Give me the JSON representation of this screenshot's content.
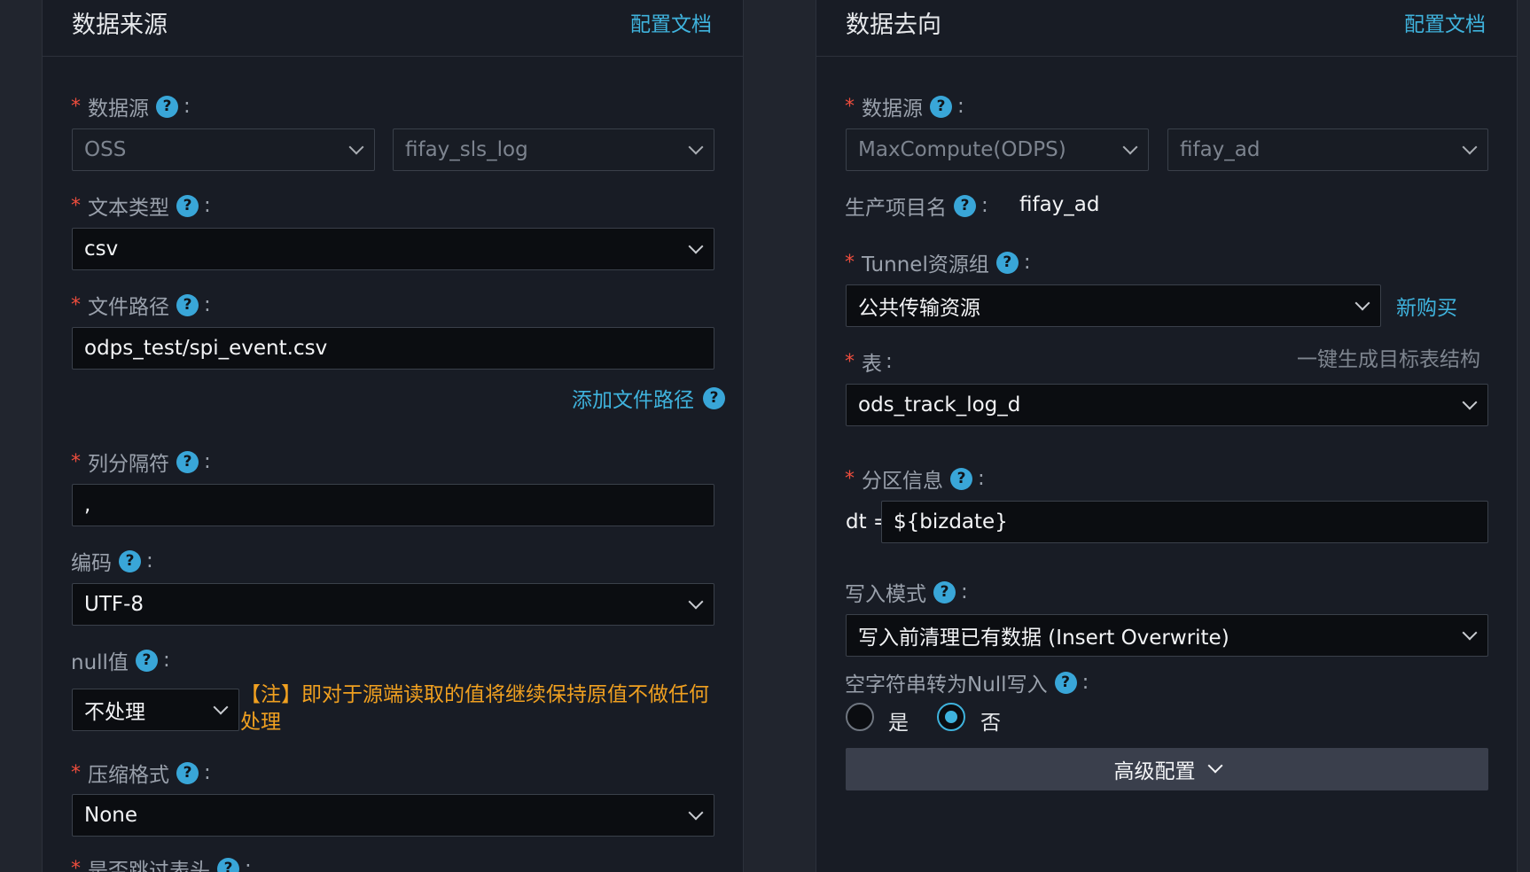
{
  "source": {
    "title": "数据来源",
    "doc_link": "配置文档",
    "datasource": {
      "label": "数据源",
      "type_value": "OSS",
      "name_value": "fifay_sls_log"
    },
    "text_type": {
      "label": "文本类型",
      "value": "csv"
    },
    "file_path": {
      "label": "文件路径",
      "value": "odps_test/spi_event.csv",
      "add_link": "添加文件路径"
    },
    "column_sep": {
      "label": "列分隔符",
      "value": ","
    },
    "encoding": {
      "label": "编码",
      "value": "UTF-8"
    },
    "null_value": {
      "label": "null值",
      "value": "不处理",
      "note": "【注】即对于源端读取的值将继续保持原值不做任何处理"
    },
    "compression": {
      "label": "压缩格式",
      "value": "None"
    },
    "skip_header": {
      "label": "是否跳过表头"
    }
  },
  "target": {
    "title": "数据去向",
    "doc_link": "配置文档",
    "datasource": {
      "label": "数据源",
      "type_value": "MaxCompute(ODPS)",
      "name_value": "fifay_ad"
    },
    "project": {
      "label": "生产项目名",
      "value": "fifay_ad"
    },
    "tunnel": {
      "label": "Tunnel资源组",
      "value": "公共传输资源",
      "buy_link": "新购买"
    },
    "table": {
      "label": "表",
      "generate_link": "一键生成目标表结构",
      "value": "ods_track_log_d"
    },
    "partition": {
      "label": "分区信息",
      "prefix": "dt =",
      "value": "${bizdate}"
    },
    "write_mode": {
      "label": "写入模式",
      "value": "写入前清理已有数据 (Insert Overwrite)"
    },
    "empty_to_null": {
      "label": "空字符串转为Null写入",
      "yes": "是",
      "no": "否",
      "selected": "否"
    },
    "advanced_button": "高级配置"
  }
}
